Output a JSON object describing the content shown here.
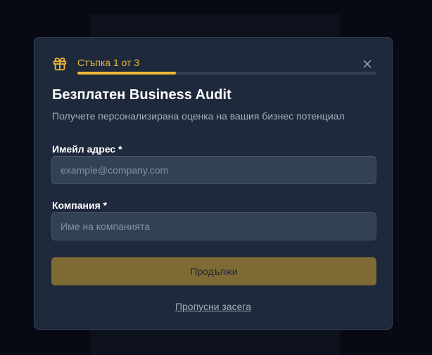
{
  "modal": {
    "step_label": "Стъпка 1 от 3",
    "progress": 0.33,
    "title": "Безплатен Business Audit",
    "subtitle": "Получете персонализирана оценка на вашия бизнес потенциал",
    "email": {
      "label": "Имейл адрес *",
      "value": "",
      "placeholder": "example@company.com"
    },
    "company": {
      "label": "Компания *",
      "value": "",
      "placeholder": "Име на компанията"
    },
    "continue_label": "Продължи",
    "skip_label": "Пропусни засега"
  },
  "colors": {
    "accent": "#f0b93a",
    "button_bg": "#7e6a33",
    "modal_bg": "#1e293b",
    "page_bg": "#070a12"
  },
  "icons": {
    "step": "gift-icon",
    "close": "close-icon"
  }
}
